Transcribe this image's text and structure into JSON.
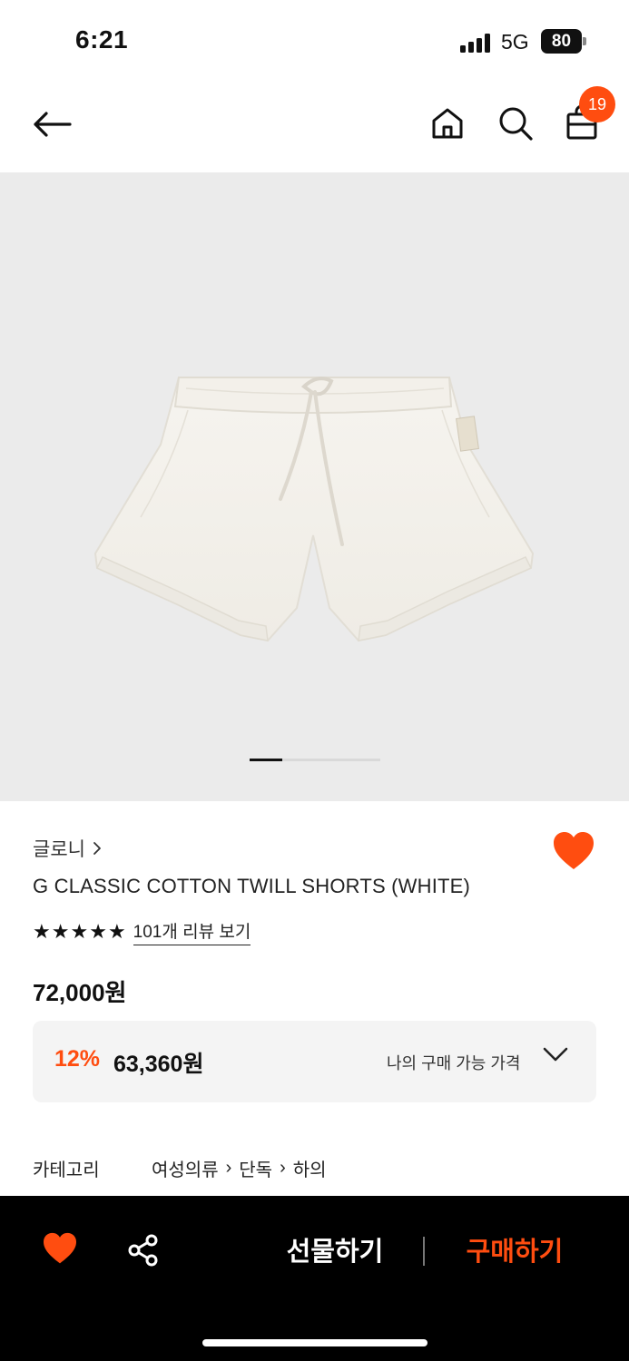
{
  "status_bar": {
    "time": "6:21",
    "network": "5G",
    "battery": "80"
  },
  "header": {
    "cart_count": "19"
  },
  "gallery": {
    "page_count": 4,
    "current_page": 1
  },
  "product": {
    "brand": "글로니",
    "name": "G CLASSIC COTTON TWILL SHORTS (WHITE)",
    "rating_stars": 5,
    "review_link": "101개 리뷰 보기",
    "original_price": "72,000원",
    "discount_rate": "12%",
    "discount_price": "63,360원",
    "my_price_label": "나의 구매 가능 가격",
    "liked": true
  },
  "category": {
    "label": "카테고리",
    "path": [
      "여성의류",
      "단독",
      "하의"
    ]
  },
  "bottom_bar": {
    "gift_label": "선물하기",
    "buy_label": "구매하기"
  },
  "colors": {
    "accent": "#ff4d10",
    "image_bg": "#ebebeb",
    "price_box_bg": "#f4f4f4",
    "bottom_bar_bg": "#000000"
  }
}
